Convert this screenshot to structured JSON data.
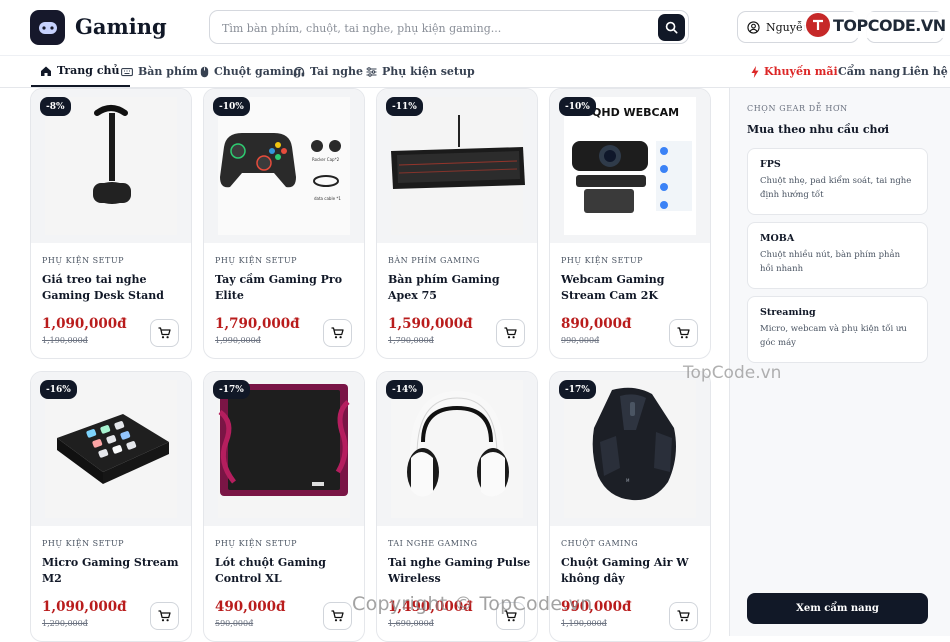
{
  "brand": {
    "name": "Gaming",
    "logo_icon": "gamepad-icon"
  },
  "search": {
    "placeholder": "Tìm bàn phím, chuột, tai nghe, phụ kiện gaming...",
    "value": ""
  },
  "user": {
    "name": "Nguyễn"
  },
  "watermarks": {
    "top": "TOPCODE.VN",
    "mid": "TopCode.vn",
    "bottom": "Copyright © TopCode.vn"
  },
  "nav": {
    "items": [
      {
        "label": "Trang chủ",
        "icon": "home-icon",
        "active": true
      },
      {
        "label": "Bàn phím",
        "icon": "keyboard-icon"
      },
      {
        "label": "Chuột gaming",
        "icon": "mouse-icon"
      },
      {
        "label": "Tai nghe",
        "icon": "headphones-icon"
      },
      {
        "label": "Phụ kiện setup",
        "icon": "sliders-icon"
      }
    ],
    "right": [
      {
        "label": "Khuyến mãi",
        "icon": "lightning-icon"
      },
      {
        "label": "Cẩm nang"
      },
      {
        "label": "Liên hệ"
      }
    ]
  },
  "products": [
    {
      "badge": "-8%",
      "category": "PHỤ KIỆN SETUP",
      "title": "Giá treo tai nghe Gaming Desk Stand",
      "price": "1,090,000đ",
      "old_price": "1,190,000đ",
      "image": "headset-stand"
    },
    {
      "badge": "-10%",
      "category": "PHỤ KIỆN SETUP",
      "title": "Tay cầm Gaming Pro Elite",
      "price": "1,790,000đ",
      "old_price": "1,990,000đ",
      "image": "gamepad",
      "image_labels": [
        "Rocker Cap*2",
        "data cable *1"
      ]
    },
    {
      "badge": "-11%",
      "category": "BÀN PHÍM GAMING",
      "title": "Bàn phím Gaming Apex 75",
      "price": "1,590,000đ",
      "old_price": "1,790,000đ",
      "image": "keyboard"
    },
    {
      "badge": "-10%",
      "category": "PHỤ KIỆN SETUP",
      "title": "Webcam Gaming Stream Cam 2K",
      "price": "890,000đ",
      "old_price": "990,000đ",
      "image": "webcam",
      "image_labels": [
        "2K QHD WEBCAM"
      ]
    },
    {
      "badge": "-16%",
      "category": "PHỤ KIỆN SETUP",
      "title": "Micro Gaming Stream M2",
      "price": "1,090,000đ",
      "old_price": "1,290,000đ",
      "image": "stream-deck"
    },
    {
      "badge": "-17%",
      "category": "PHỤ KIỆN SETUP",
      "title": "Lót chuột Gaming Control XL",
      "price": "490,000đ",
      "old_price": "590,000đ",
      "image": "mousepad"
    },
    {
      "badge": "-14%",
      "category": "TAI NGHE GAMING",
      "title": "Tai nghe Gaming Pulse Wireless",
      "price": "1,490,000đ",
      "old_price": "1,690,000đ",
      "image": "headphones"
    },
    {
      "badge": "-17%",
      "category": "CHUỘT GAMING",
      "title": "Chuột Gaming Air W không dây",
      "price": "990,000đ",
      "old_price": "1,190,000đ",
      "image": "mouse"
    }
  ],
  "sidebar": {
    "eyebrow": "CHỌN GEAR DỄ HƠN",
    "title": "Mua theo nhu cầu chơi",
    "cards": [
      {
        "title": "FPS",
        "desc": "Chuột nhẹ, pad kiểm soát, tai nghe định hướng tốt"
      },
      {
        "title": "MOBA",
        "desc": "Chuột nhiều nút, bàn phím phản hồi nhanh"
      },
      {
        "title": "Streaming",
        "desc": "Micro, webcam và phụ kiện tối ưu góc máy"
      }
    ],
    "cta": "Xem cẩm nang"
  },
  "colors": {
    "primary": "#111827",
    "price": "#b91c1c",
    "promo": "#dc2626"
  }
}
